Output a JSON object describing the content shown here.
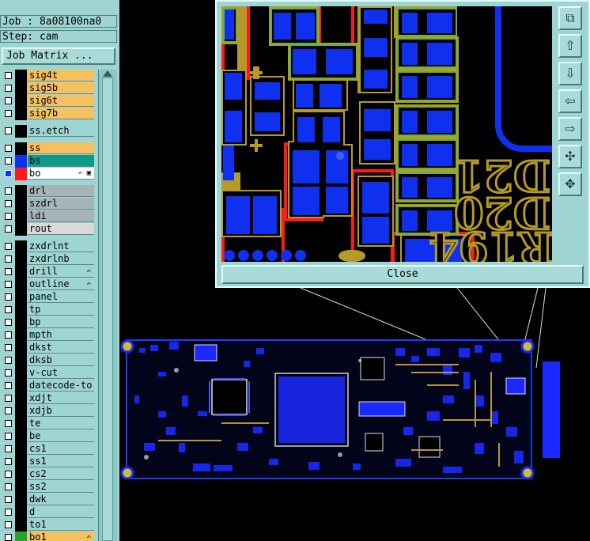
{
  "job_label": "Job : 8a08100na0",
  "step_label": "Step: cam",
  "job_matrix_button": "Job Matrix ...",
  "close_button": "Close",
  "zoom_text": {
    "d21": "D21",
    "d20": "D20",
    "r194": "R194"
  },
  "colors": {
    "panel_bg": "#9ed4d2",
    "signal_layer": "#f5c060",
    "solder_mask_layer": "#0d9a8a",
    "drill_layer": "#a7b3b8",
    "rout_layer": "#d9d9d9",
    "pad_blue": "#1030f0",
    "copper_gold": "#b59a2a",
    "trace_red": "#ff1a1a"
  },
  "layers": [
    {
      "name": "sig4t",
      "color": "",
      "fill": "#f5c060"
    },
    {
      "name": "sig5b",
      "color": "",
      "fill": "#f5c060"
    },
    {
      "name": "sig6t",
      "color": "",
      "fill": "#f5c060"
    },
    {
      "name": "sig7b",
      "color": "",
      "fill": "#f5c060"
    },
    {
      "gap": true
    },
    {
      "name": "ss.etch",
      "color": "",
      "fill": "#9ed4d2"
    },
    {
      "gap": true
    },
    {
      "name": "ss",
      "color": "",
      "fill": "#f5c060"
    },
    {
      "name": "bs",
      "color": "#1030f0",
      "fill": "#0d9a8a"
    },
    {
      "name": "bo",
      "color": "#ff1a1a",
      "fill": "#ffffff",
      "mark": "✍ ▣",
      "checked": true
    },
    {
      "gap": true
    },
    {
      "name": "drl",
      "color": "",
      "fill": "#a7b3b8"
    },
    {
      "name": "szdrl",
      "color": "",
      "fill": "#a7b3b8"
    },
    {
      "name": "ldi",
      "color": "",
      "fill": "#a7b3b8"
    },
    {
      "name": "rout",
      "color": "",
      "fill": "#d9d9d9"
    },
    {
      "gap": true
    },
    {
      "name": "zxdrlnt",
      "color": "",
      "fill": "#9ed4d2"
    },
    {
      "name": "zxdrlnb",
      "color": "",
      "fill": "#9ed4d2"
    },
    {
      "name": "drill",
      "color": "",
      "fill": "#9ed4d2",
      "mark": "✍"
    },
    {
      "name": "outline",
      "color": "",
      "fill": "#9ed4d2",
      "mark": "✍"
    },
    {
      "name": "panel",
      "color": "",
      "fill": "#9ed4d2"
    },
    {
      "name": "tp",
      "color": "",
      "fill": "#9ed4d2"
    },
    {
      "name": "bp",
      "color": "",
      "fill": "#9ed4d2"
    },
    {
      "name": "mpth",
      "color": "",
      "fill": "#9ed4d2"
    },
    {
      "name": "dkst",
      "color": "",
      "fill": "#9ed4d2"
    },
    {
      "name": "dksb",
      "color": "",
      "fill": "#9ed4d2"
    },
    {
      "name": "v-cut",
      "color": "",
      "fill": "#9ed4d2"
    },
    {
      "name": "datecode-to",
      "color": "",
      "fill": "#9ed4d2"
    },
    {
      "name": "xdjt",
      "color": "",
      "fill": "#9ed4d2"
    },
    {
      "name": "xdjb",
      "color": "",
      "fill": "#9ed4d2"
    },
    {
      "name": "te",
      "color": "",
      "fill": "#9ed4d2"
    },
    {
      "name": "be",
      "color": "",
      "fill": "#9ed4d2"
    },
    {
      "name": "cs1",
      "color": "",
      "fill": "#9ed4d2"
    },
    {
      "name": "ss1",
      "color": "",
      "fill": "#9ed4d2"
    },
    {
      "name": "cs2",
      "color": "",
      "fill": "#9ed4d2"
    },
    {
      "name": "ss2",
      "color": "",
      "fill": "#9ed4d2"
    },
    {
      "name": "dwk",
      "color": "",
      "fill": "#9ed4d2"
    },
    {
      "name": "d",
      "color": "",
      "fill": "#9ed4d2"
    },
    {
      "name": "to1",
      "color": "",
      "fill": "#9ed4d2"
    },
    {
      "name": "bo1",
      "color": "#2ea02e",
      "fill": "#f5c060",
      "mark": "✍"
    }
  ],
  "toolbar_icons": [
    "zoom-fit-icon",
    "move-up-icon",
    "move-down-icon",
    "move-left-icon",
    "move-right-icon",
    "zoom-out-icon",
    "zoom-in-icon"
  ]
}
